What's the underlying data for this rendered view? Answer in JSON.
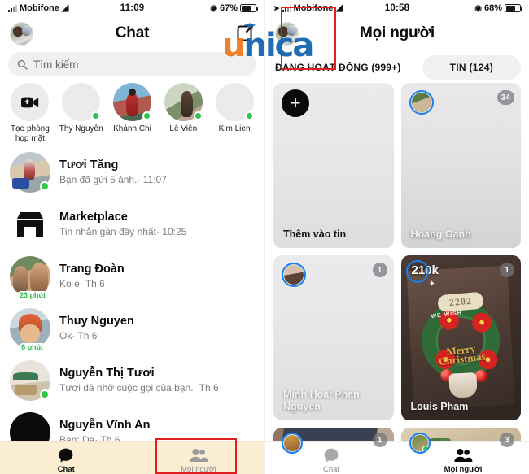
{
  "watermark": {
    "part1": "u",
    "part2": "nica",
    "name": "unica-logo",
    "color_orange": "#f07c20",
    "color_blue": "#1667b2"
  },
  "left_phone": {
    "status_bar": {
      "carrier": "Mobifone",
      "time": "11:09",
      "battery": "67%",
      "wifi_icon": "wifi-icon",
      "signal_icon": "signal-bars-icon",
      "battery_icon": "battery-icon",
      "location_icon": "location-icon"
    },
    "header": {
      "title": "Chat",
      "avatar_name": "user-avatar",
      "compose_icon": "compose-icon"
    },
    "search": {
      "placeholder": "Tìm kiếm",
      "icon": "search-icon"
    },
    "stories": [
      {
        "label": "Tạo phòng họp mặt",
        "type": "create-room",
        "icon": "video-plus-icon",
        "online": false
      },
      {
        "label": "Thy Nguyễn",
        "type": "avatar",
        "online": true
      },
      {
        "label": "Khánh Chi",
        "type": "avatar",
        "online": true
      },
      {
        "label": "Lê Viên",
        "type": "avatar",
        "online": true
      },
      {
        "label": "Kim Lien",
        "type": "avatar",
        "online": true
      }
    ],
    "chats": [
      {
        "name": "Tươi Tăng",
        "preview": "Bạn đã gửi 5 ảnh.· 11:07",
        "online": true,
        "badge": ""
      },
      {
        "name": "Marketplace",
        "preview": "Tin nhắn gần đây nhất· 10:25",
        "online": false,
        "badge": "",
        "icon": "marketplace-icon"
      },
      {
        "name": "Trang Đoàn",
        "preview": "Ko e· Th 6",
        "online": false,
        "badge": "23 phút"
      },
      {
        "name": "Thuy Nguyen",
        "preview": "Ok· Th 6",
        "online": false,
        "badge": "6 phút"
      },
      {
        "name": "Nguyễn Thị Tươi",
        "preview": "Tươi đã nhỡ cuộc gọi của bạn.· Th 6",
        "online": true,
        "badge": ""
      },
      {
        "name": "Nguyễn Vĩnh An",
        "preview": "Bạn: Dạ· Th 6",
        "online": false,
        "badge": ""
      }
    ],
    "tabbar": [
      {
        "label": "Chat",
        "icon": "chat-bubble-icon",
        "active": true
      },
      {
        "label": "Mọi người",
        "icon": "people-icon",
        "active": false
      }
    ]
  },
  "right_phone": {
    "status_bar": {
      "carrier": "Mobifone",
      "time": "10:58",
      "battery": "68%",
      "wifi_icon": "wifi-icon",
      "signal_icon": "signal-bars-icon",
      "battery_icon": "battery-icon",
      "location_icon": "location-icon"
    },
    "header": {
      "title": "Mọi người",
      "avatar_name": "user-avatar"
    },
    "tabs": [
      {
        "label": "ĐANG HOẠT ĐỘNG (999+)",
        "active": false,
        "style": "plain"
      },
      {
        "label": "TIN (124)",
        "active": true,
        "style": "pill"
      }
    ],
    "story_cards": [
      {
        "label": "Thêm vào tin",
        "type": "add",
        "add_icon": "plus-icon",
        "count": ""
      },
      {
        "label": "Hoàng Oanh",
        "type": "story",
        "count": "34"
      },
      {
        "label": "Minh Hoai Phan Nguyen",
        "type": "story",
        "count": "1"
      },
      {
        "label": "Louis Pham",
        "type": "story-photo",
        "count": "1",
        "overlay_text": "210k",
        "photo_badge": "2202",
        "photo_wish": "WE WISH",
        "photo_greeting": "Merry Christmas"
      },
      {
        "label": "",
        "type": "partial-tablet",
        "count": "1"
      },
      {
        "label": "",
        "type": "partial-sand",
        "count": "3"
      }
    ],
    "tabbar": [
      {
        "label": "Chat",
        "icon": "chat-bubble-icon",
        "active": false
      },
      {
        "label": "Mọi người",
        "icon": "people-icon",
        "active": true
      }
    ]
  },
  "highlights": [
    {
      "name": "add-story-highlight",
      "color": "#e02020"
    },
    {
      "name": "people-tab-highlight",
      "color": "#e02020"
    }
  ]
}
